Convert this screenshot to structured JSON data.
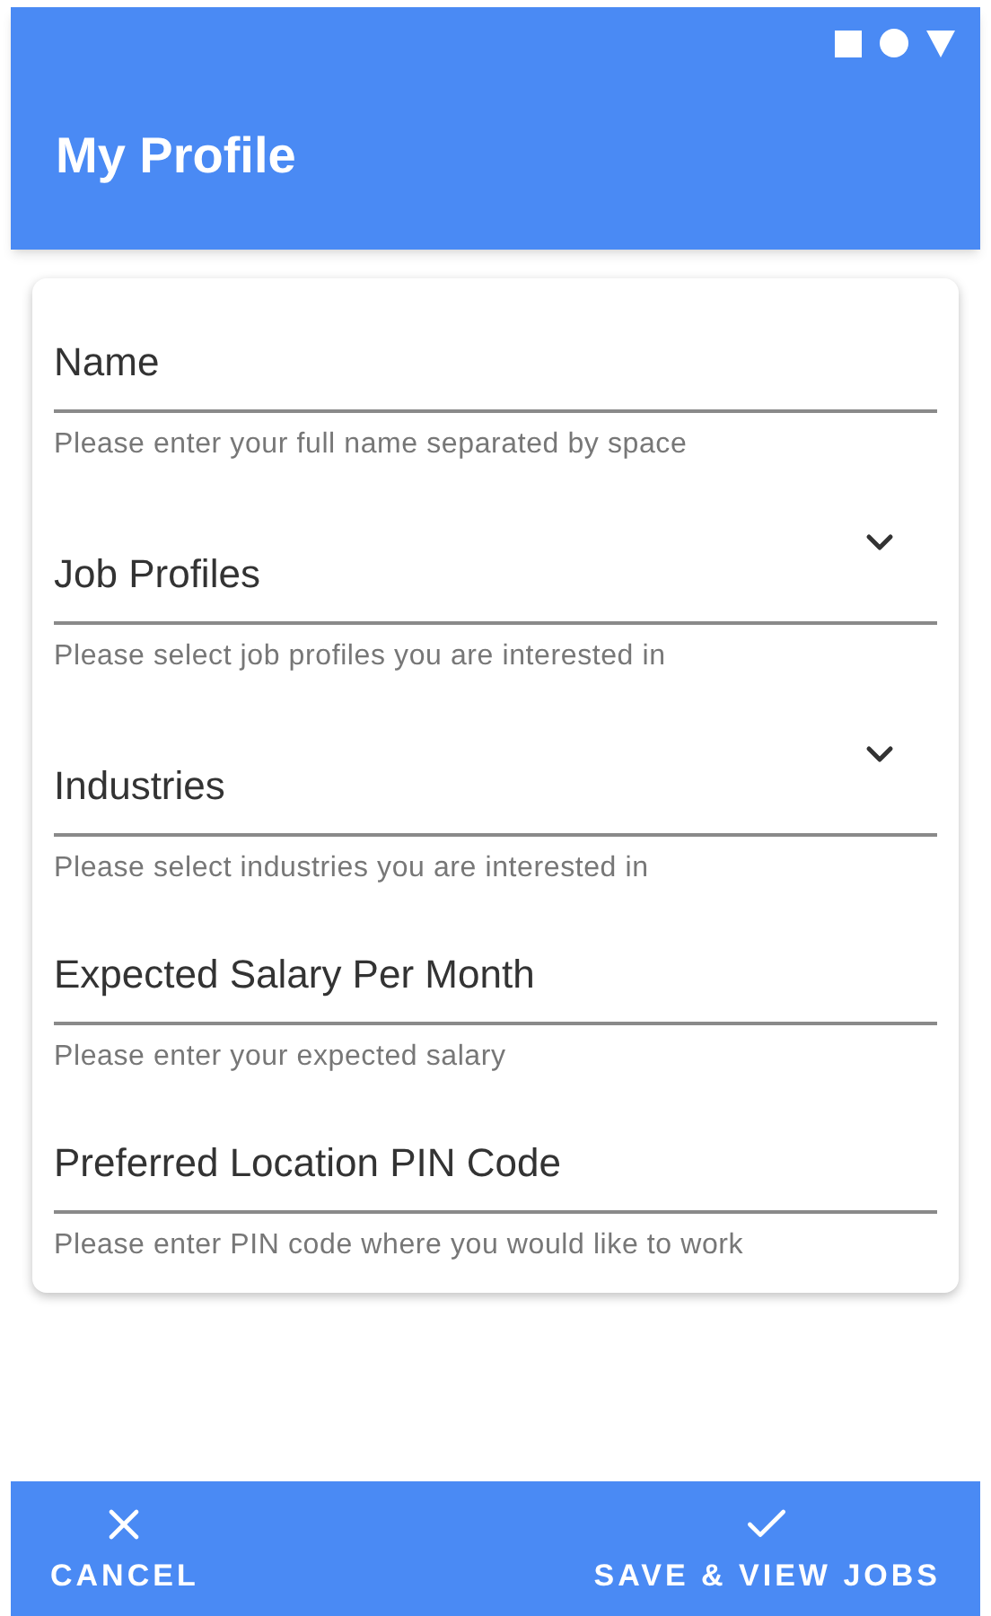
{
  "app_bar": {
    "title": "My Profile"
  },
  "fields": [
    {
      "kind": "text",
      "placeholder": "Name",
      "helper": "Please enter your full name separated by space"
    },
    {
      "kind": "select",
      "placeholder": "Job Profiles",
      "helper": "Please select job profiles you are interested in"
    },
    {
      "kind": "select",
      "placeholder": "Industries",
      "helper": "Please select industries you are interested in"
    },
    {
      "kind": "text",
      "placeholder": "Expected Salary Per Month",
      "helper": "Please enter your expected salary"
    },
    {
      "kind": "text",
      "placeholder": "Preferred Location PIN Code",
      "helper": "Please enter PIN code where you would like to work"
    }
  ],
  "actions": [
    {
      "kind": "cancel",
      "label": "CANCEL"
    },
    {
      "kind": "confirm",
      "label": "SAVE & VIEW JOBS"
    }
  ]
}
